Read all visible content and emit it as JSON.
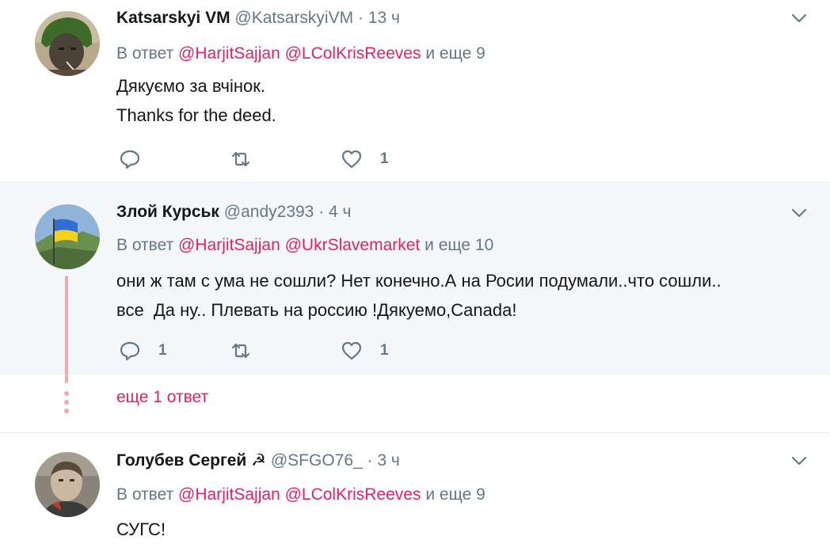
{
  "tweets": [
    {
      "name": "Katsarskyi VM",
      "handle": "@KatsarskyiVM",
      "dot": "·",
      "time": "13 ч",
      "reply_prefix": "В ответ",
      "mentions": [
        "@HarjitSajjan",
        "@LColKrisReeves"
      ],
      "reply_suffix": "и еще 9",
      "text": "Дякуємо за вчінок.\nThanks for the deed.",
      "reply_count": "",
      "retweet_count": "",
      "like_count": "1"
    },
    {
      "name": "Злой Курськ",
      "handle": "@andy2393",
      "dot": "·",
      "time": "4 ч",
      "reply_prefix": "В ответ",
      "mentions": [
        "@HarjitSajjan",
        "@UkrSlavemarket"
      ],
      "reply_suffix": "и еще 10",
      "text": "они ж там с ума не сошли? Нет конечно.А на Росии подумали..что сошли..\nвсе  Да ну.. Плевать на россию !Дякуемо,Canada!",
      "reply_count": "1",
      "retweet_count": "",
      "like_count": "1"
    },
    {
      "name": "Голубев Сергей ☭",
      "handle": "@SFGO76_",
      "dot": "·",
      "time": "3 ч",
      "reply_prefix": "В ответ",
      "mentions": [
        "@HarjitSajjan",
        "@LColKrisReeves"
      ],
      "reply_suffix": "и еще 9",
      "text": "СУГС!"
    }
  ],
  "more_replies": "еще 1 ответ",
  "icons": {
    "reply": "reply-icon",
    "retweet": "retweet-icon",
    "like": "heart-icon",
    "menu": "chevron-down-icon"
  },
  "colors": {
    "accent": "#e0245e",
    "secondary_text": "#657786",
    "thread_line": "#f2a7ad",
    "highlight_bg": "#f5f8fa"
  }
}
